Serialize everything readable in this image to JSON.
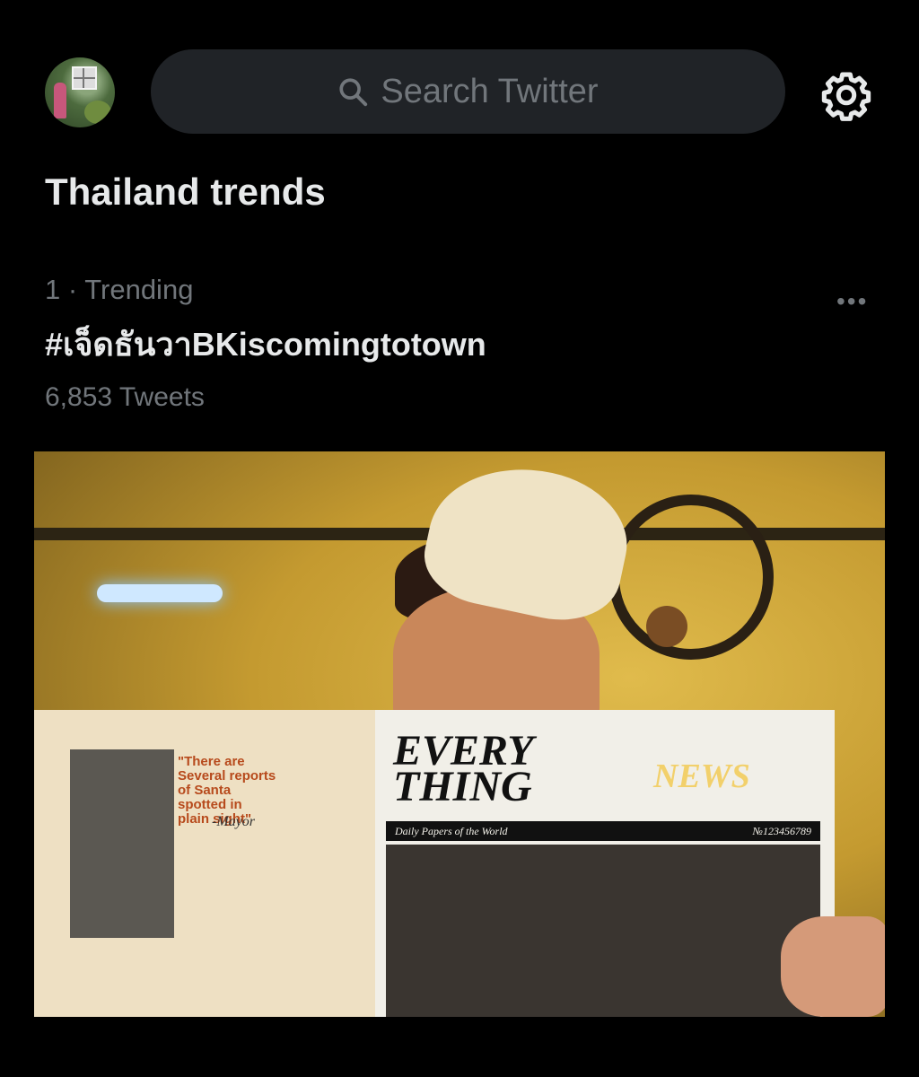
{
  "header": {
    "search_placeholder": "Search Twitter",
    "icons": [
      "avatar",
      "search-icon",
      "gear-icon"
    ]
  },
  "section": {
    "title": "Thailand trends"
  },
  "trend": {
    "rank_label": "1 · Trending",
    "name": "#เจ็ดธันวาBKiscomingtotown",
    "tweet_count": "6,853 Tweets",
    "more_label": "•••"
  },
  "media": {
    "quote": "\"There are Several reports of Santa spotted in plain sight\"",
    "quote_by": "-Mayor",
    "headline": "EVERY THING",
    "headline_accent": "NEWS",
    "banner_left": "Daily Papers of the World",
    "banner_right": "№123456789"
  },
  "colors": {
    "background": "#000000",
    "search_bg": "#202327",
    "muted_text": "#71767b",
    "primary_text": "#e7e9ea"
  }
}
